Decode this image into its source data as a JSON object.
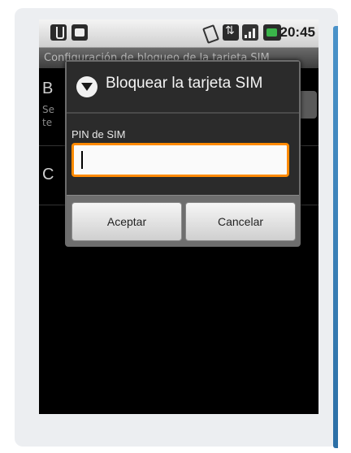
{
  "status_bar": {
    "time": "20:45",
    "icons": [
      "usb-icon",
      "sd-card-icon",
      "vibrate-icon",
      "data-sync-icon",
      "signal-icon",
      "battery-icon"
    ]
  },
  "screen": {
    "title": "Configuración de bloqueo de la tarjeta SIM",
    "row1_letter": "B",
    "row1_sub1": "Se",
    "row1_sub2": "te",
    "row2_letter": "C"
  },
  "dialog": {
    "title": "Bloquear la tarjeta SIM",
    "field_label": "PIN de SIM",
    "pin_value": "",
    "accept_label": "Aceptar",
    "cancel_label": "Cancelar"
  },
  "colors": {
    "focus_border": "#ff8a00",
    "battery": "#3ab54a",
    "accent_edge": "#2c6fa6"
  }
}
